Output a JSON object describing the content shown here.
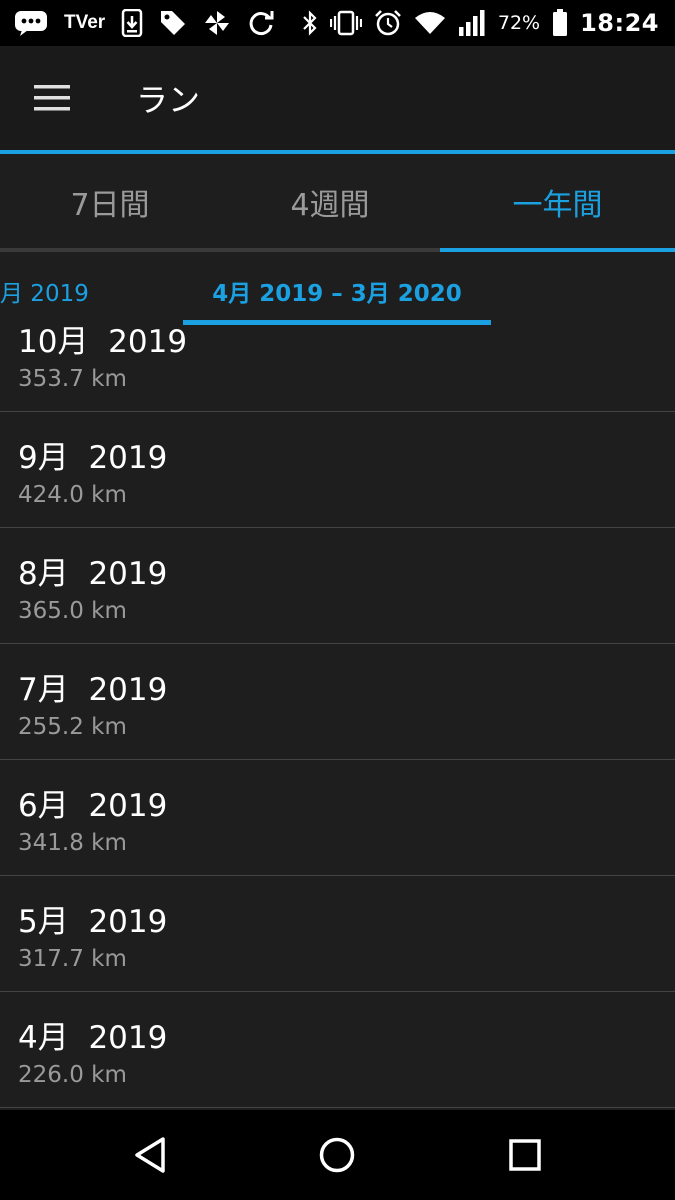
{
  "status_bar": {
    "left_icons": [
      "chat-bubble-icon",
      "tver-icon",
      "download-icon",
      "tag-icon",
      "pinwheel-icon",
      "sync-icon"
    ],
    "tver_label": "TVer",
    "right_icons": [
      "bluetooth-icon",
      "vibrate-icon",
      "alarm-icon",
      "wifi-icon",
      "signal-icon",
      "battery-icon"
    ],
    "battery_percent": "72%",
    "time": "18:24"
  },
  "app_bar": {
    "menu_icon": "hamburger-menu-icon",
    "title": "ラン"
  },
  "period_tabs": [
    {
      "label": "7日間",
      "selected": false
    },
    {
      "label": "4週間",
      "selected": false
    },
    {
      "label": "一年間",
      "selected": true
    }
  ],
  "range": {
    "previous": "月 2019",
    "current": "4月 2019 – 3月 2020"
  },
  "months": [
    {
      "month": "10月",
      "year": "2019",
      "distance": "353.7 km"
    },
    {
      "month": "9月",
      "year": "2019",
      "distance": "424.0 km"
    },
    {
      "month": "8月",
      "year": "2019",
      "distance": "365.0 km"
    },
    {
      "month": "7月",
      "year": "2019",
      "distance": "255.2 km"
    },
    {
      "month": "6月",
      "year": "2019",
      "distance": "341.8 km"
    },
    {
      "month": "5月",
      "year": "2019",
      "distance": "317.7 km"
    },
    {
      "month": "4月",
      "year": "2019",
      "distance": "226.0 km"
    }
  ],
  "nav_bar": {
    "icons": [
      "back-triangle-icon",
      "home-circle-icon",
      "recents-square-icon"
    ]
  },
  "colors": {
    "accent": "#1ba1e2",
    "background": "#1e1e1e",
    "app_bar": "#1a1a1a",
    "secondary_text": "#9a9a9a",
    "divider": "#444444"
  }
}
